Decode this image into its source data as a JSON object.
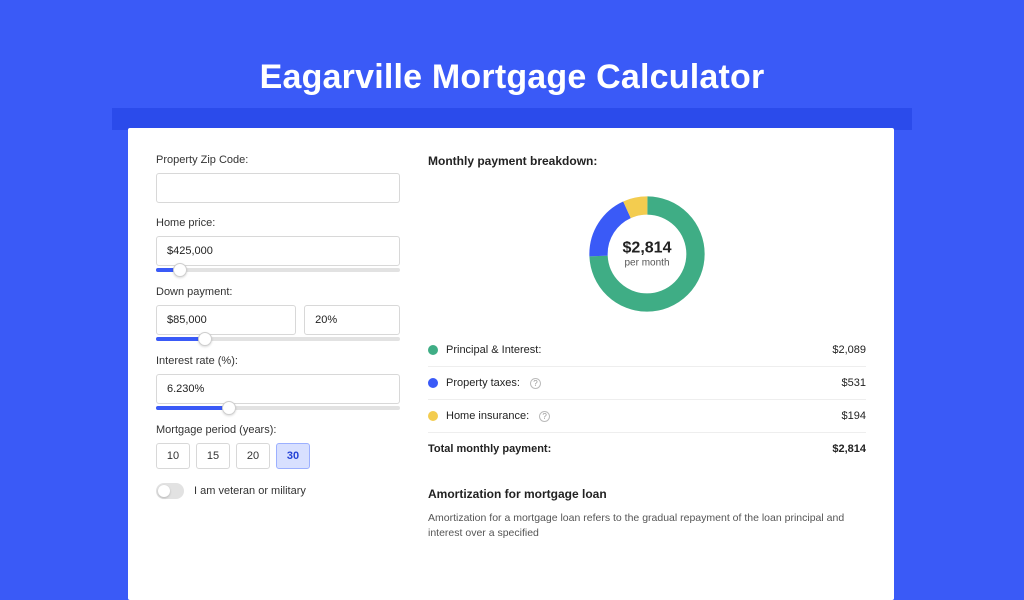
{
  "page_title": "Eagarville Mortgage Calculator",
  "colors": {
    "principal": "#3fad85",
    "taxes": "#3a5af7",
    "insurance": "#f3cc4f"
  },
  "form": {
    "zip": {
      "label": "Property Zip Code:",
      "value": ""
    },
    "home_price": {
      "label": "Home price:",
      "value": "$425,000",
      "slider_pct": 10
    },
    "down_payment": {
      "label": "Down payment:",
      "value": "$85,000",
      "pct_value": "20%",
      "slider_pct": 20
    },
    "interest": {
      "label": "Interest rate (%):",
      "value": "6.230%",
      "slider_pct": 30
    },
    "period": {
      "label": "Mortgage period (years):",
      "options": [
        "10",
        "15",
        "20",
        "30"
      ],
      "selected": "30"
    },
    "veteran": {
      "label": "I am veteran or military",
      "checked": false
    }
  },
  "breakdown": {
    "title": "Monthly payment breakdown:",
    "center_value": "$2,814",
    "center_sub": "per month",
    "rows": [
      {
        "label": "Principal & Interest:",
        "value": "$2,089",
        "color": "#3fad85",
        "info": false
      },
      {
        "label": "Property taxes:",
        "value": "$531",
        "color": "#3a5af7",
        "info": true
      },
      {
        "label": "Home insurance:",
        "value": "$194",
        "color": "#f3cc4f",
        "info": true
      }
    ],
    "total": {
      "label": "Total monthly payment:",
      "value": "$2,814"
    }
  },
  "amortization": {
    "title": "Amortization for mortgage loan",
    "text": "Amortization for a mortgage loan refers to the gradual repayment of the loan principal and interest over a specified"
  },
  "chart_data": {
    "type": "pie",
    "title": "Monthly payment breakdown",
    "series": [
      {
        "name": "Principal & Interest",
        "value": 2089,
        "color": "#3fad85"
      },
      {
        "name": "Property taxes",
        "value": 531,
        "color": "#3a5af7"
      },
      {
        "name": "Home insurance",
        "value": 194,
        "color": "#f3cc4f"
      }
    ],
    "total": 2814
  }
}
